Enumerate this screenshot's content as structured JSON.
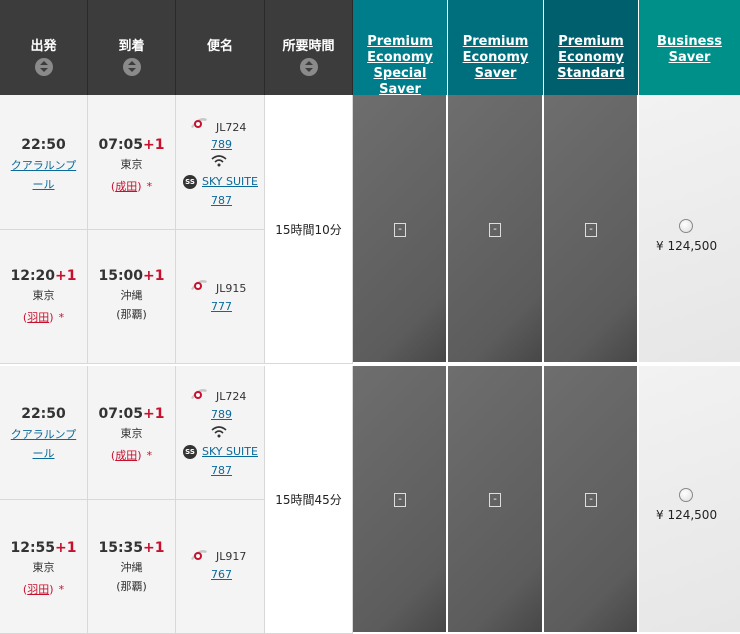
{
  "columns": {
    "departure": "出発",
    "arrival": "到着",
    "flight": "便名",
    "duration": "所要時間"
  },
  "fares": [
    {
      "line1": "Premium",
      "line2": "Economy",
      "line3": "Special Saver",
      "color": "#007d8a"
    },
    {
      "line1": "Premium",
      "line2": "Economy",
      "line3": "Saver",
      "color": "#006f7d"
    },
    {
      "line1": "Premium",
      "line2": "Economy",
      "line3": "Standard",
      "color": "#005f6c"
    },
    {
      "line1": "Business",
      "line2": "Saver",
      "line3": "",
      "color": "#00908a"
    }
  ],
  "itineraries": [
    {
      "duration": "15時間10分",
      "price": "¥ 124,500",
      "legs": [
        {
          "dep_time": "22:50",
          "dep_plus": "",
          "dep_city_link": "クアラルンプ",
          "dep_city_link2": "ール",
          "arr_time": "07:05",
          "arr_plus": "+1",
          "arr_city": "東京",
          "arr_airport": "成田",
          "flight": "JL724",
          "aircraft": "789",
          "seat": "SKY SUITE",
          "seat_aircraft": "787"
        },
        {
          "dep_time": "12:20",
          "dep_plus": "+1",
          "dep_city": "東京",
          "dep_airport": "羽田",
          "arr_time": "15:00",
          "arr_plus": "+1",
          "arr_city": "沖縄",
          "arr_airport": "(那覇)",
          "flight": "JL915",
          "aircraft": "777"
        }
      ]
    },
    {
      "duration": "15時間45分",
      "price": "¥ 124,500",
      "legs": [
        {
          "dep_time": "22:50",
          "dep_plus": "",
          "dep_city_link": "クアラルンプ",
          "dep_city_link2": "ール",
          "arr_time": "07:05",
          "arr_plus": "+1",
          "arr_city": "東京",
          "arr_airport": "成田",
          "flight": "JL724",
          "aircraft": "789",
          "seat": "SKY SUITE",
          "seat_aircraft": "787"
        },
        {
          "dep_time": "12:55",
          "dep_plus": "+1",
          "dep_city": "東京",
          "dep_airport": "羽田",
          "arr_time": "15:35",
          "arr_plus": "+1",
          "arr_city": "沖縄",
          "arr_airport": "(那覇)",
          "flight": "JL917",
          "aircraft": "767"
        }
      ]
    }
  ],
  "unavailable_mark": "-",
  "asterisk": "*",
  "ss_badge": "SS"
}
